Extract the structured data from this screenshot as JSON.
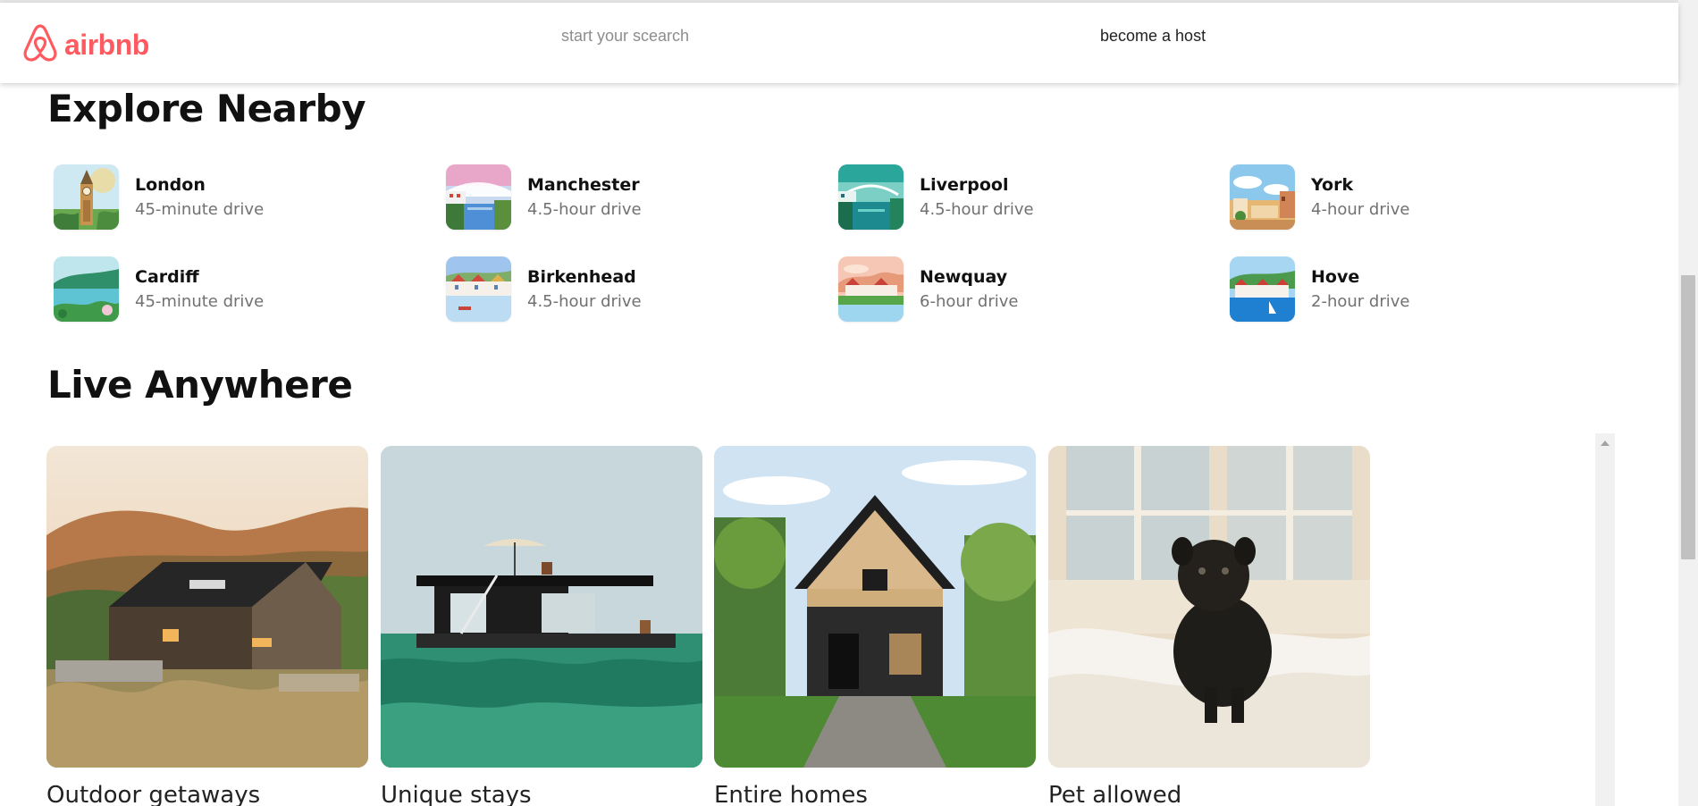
{
  "header": {
    "logo_text": "airbnb",
    "search_placeholder": "start your scearch",
    "host_link": "become a host"
  },
  "colors": {
    "brand": "#ff5a5f",
    "muted_text": "#717171"
  },
  "explore": {
    "title": "Explore Nearby",
    "places": [
      {
        "name": "London",
        "distance": "45-minute drive",
        "icon": "big-ben-illustration"
      },
      {
        "name": "Manchester",
        "distance": "4.5-hour drive",
        "icon": "bridge-river-illustration"
      },
      {
        "name": "Liverpool",
        "distance": "4.5-hour drive",
        "icon": "bridge-river-illustration"
      },
      {
        "name": "York",
        "distance": "4-hour drive",
        "icon": "town-sky-illustration"
      },
      {
        "name": "Cardiff",
        "distance": "45-minute drive",
        "icon": "lake-hills-illustration"
      },
      {
        "name": "Birkenhead",
        "distance": "4.5-hour drive",
        "icon": "harbour-houses-illustration"
      },
      {
        "name": "Newquay",
        "distance": "6-hour drive",
        "icon": "coast-houses-illustration"
      },
      {
        "name": "Hove",
        "distance": "2-hour drive",
        "icon": "seaside-houses-illustration"
      }
    ]
  },
  "live": {
    "title": "Live Anywhere",
    "cards": [
      {
        "title": "Outdoor getaways",
        "image": "dark-cabin-hills-photo"
      },
      {
        "title": "Unique stays",
        "image": "houseboat-sea-photo"
      },
      {
        "title": "Entire homes",
        "image": "a-frame-house-photo"
      },
      {
        "title": "Pet allowed",
        "image": "pug-on-bed-photo"
      }
    ]
  }
}
